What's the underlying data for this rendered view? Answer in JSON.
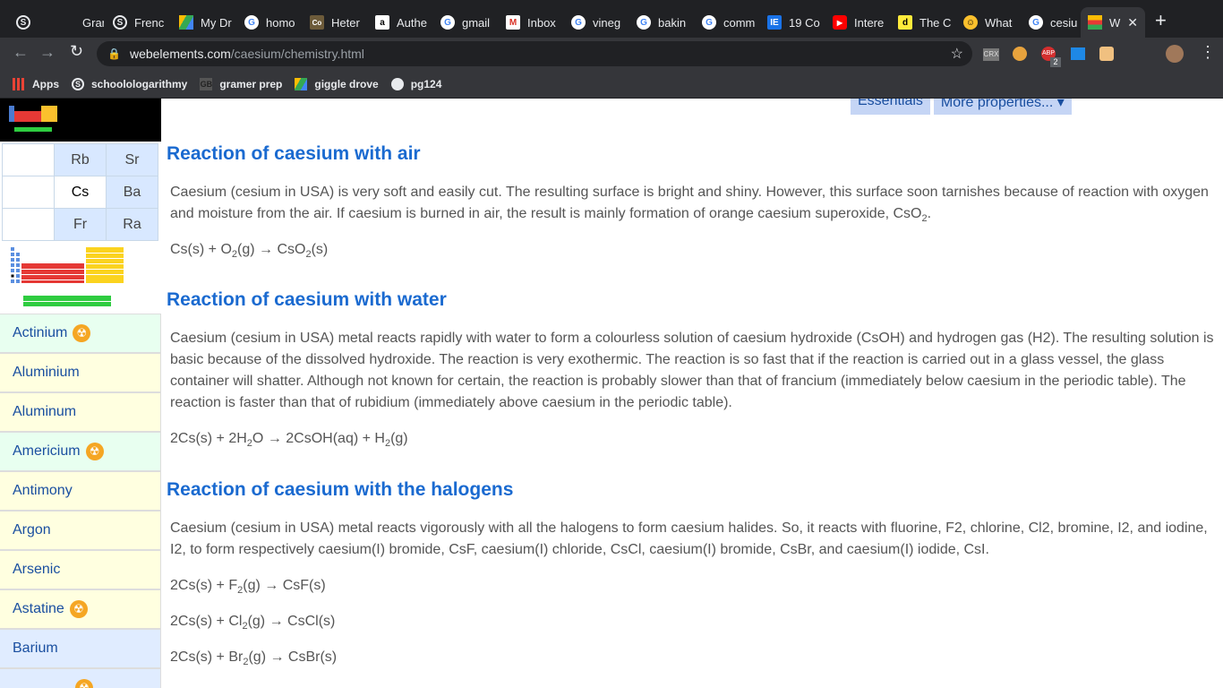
{
  "tabs": [
    {
      "label": "",
      "icon": "s-icon"
    },
    {
      "label": "Gram",
      "icon": "grammar-icon"
    },
    {
      "label": "Frenc",
      "icon": "s-icon"
    },
    {
      "label": "My Dr",
      "icon": "drive-icon"
    },
    {
      "label": "homo",
      "icon": "google-icon"
    },
    {
      "label": "Heter",
      "icon": "co-icon"
    },
    {
      "label": "Authe",
      "icon": "amazon-icon"
    },
    {
      "label": "gmail",
      "icon": "google-icon"
    },
    {
      "label": "Inbox",
      "icon": "gmail-icon"
    },
    {
      "label": "vineg",
      "icon": "google-icon"
    },
    {
      "label": "bakin",
      "icon": "google-icon"
    },
    {
      "label": "comm",
      "icon": "google-icon"
    },
    {
      "label": "19 Co",
      "icon": "ie-icon"
    },
    {
      "label": "Intere",
      "icon": "youtube-icon"
    },
    {
      "label": "The C",
      "icon": "d-icon"
    },
    {
      "label": "What",
      "icon": "smiley-icon"
    },
    {
      "label": "cesiu",
      "icon": "google-icon"
    },
    {
      "label": "W",
      "icon": "webelements-icon"
    }
  ],
  "url": {
    "domain": "webelements.com",
    "path": "/caesium/chemistry.html"
  },
  "bookmarks": [
    {
      "label": "Apps"
    },
    {
      "label": "schoolologarithmy"
    },
    {
      "label": "gramer prep"
    },
    {
      "label": "giggle drove"
    },
    {
      "label": "pg124"
    }
  ],
  "extension_badge": "2",
  "top_tabs": {
    "essentials": "Essentials",
    "more": "More properties... ▾"
  },
  "ptable": {
    "row1": [
      "",
      "Rb",
      "Sr"
    ],
    "row2": [
      "",
      "Cs",
      "Ba"
    ],
    "row3": [
      "",
      "Fr",
      "Ra"
    ]
  },
  "sidebar": [
    {
      "label": "Actinium",
      "radioactive": true
    },
    {
      "label": "Aluminium",
      "radioactive": false
    },
    {
      "label": "Aluminum",
      "radioactive": false
    },
    {
      "label": "Americium",
      "radioactive": true
    },
    {
      "label": "Antimony",
      "radioactive": false
    },
    {
      "label": "Argon",
      "radioactive": false
    },
    {
      "label": "Arsenic",
      "radioactive": false
    },
    {
      "label": "Astatine",
      "radioactive": true
    },
    {
      "label": "Barium",
      "radioactive": false
    }
  ],
  "sections": {
    "air": {
      "heading": "Reaction of caesium with air",
      "text": "Caesium (cesium in USA) is very soft and easily cut. The resulting surface is bright and shiny. However, this surface soon tarnishes because of reaction with oxygen and moisture from the air. If caesium is burned in air, the result is mainly formation of orange caesium superoxide, CsO",
      "eq": "Cs(s) + O2(g) → CsO2(s)"
    },
    "water": {
      "heading": "Reaction of caesium with water",
      "text": "Caesium (cesium in USA) metal reacts rapidly with water to form a colourless solution of caesium hydroxide (CsOH) and hydrogen gas (H2). The resulting solution is basic because of the dissolved hydroxide. The reaction is very exothermic. The reaction is so fast that if the reaction is carried out in a glass vessel, the glass container will shatter. Although not known for certain, the reaction is probably slower than that of francium (immediately below caesium in the periodic table). The reaction is faster than that of rubidium (immediately above caesium in the periodic table).",
      "eq": "2Cs(s) + 2H2O → 2CsOH(aq) + H2(g)"
    },
    "halogens": {
      "heading": "Reaction of caesium with the halogens",
      "text": "Caesium (cesium in USA) metal reacts vigorously with all the halogens to form caesium halides. So, it reacts with fluorine, F2, chlorine, Cl2, bromine, I2, and iodine, I2, to form respectively caesium(I) bromide, CsF, caesium(I) chloride, CsCl, caesium(I) bromide, CsBr, and caesium(I) iodide, CsI.",
      "eq1": "2Cs(s) + F2(g) → CsF(s)",
      "eq2": "2Cs(s) + Cl2(g) → CsCl(s)",
      "eq3": "2Cs(s) + Br2(g) → CsBr(s)"
    }
  }
}
